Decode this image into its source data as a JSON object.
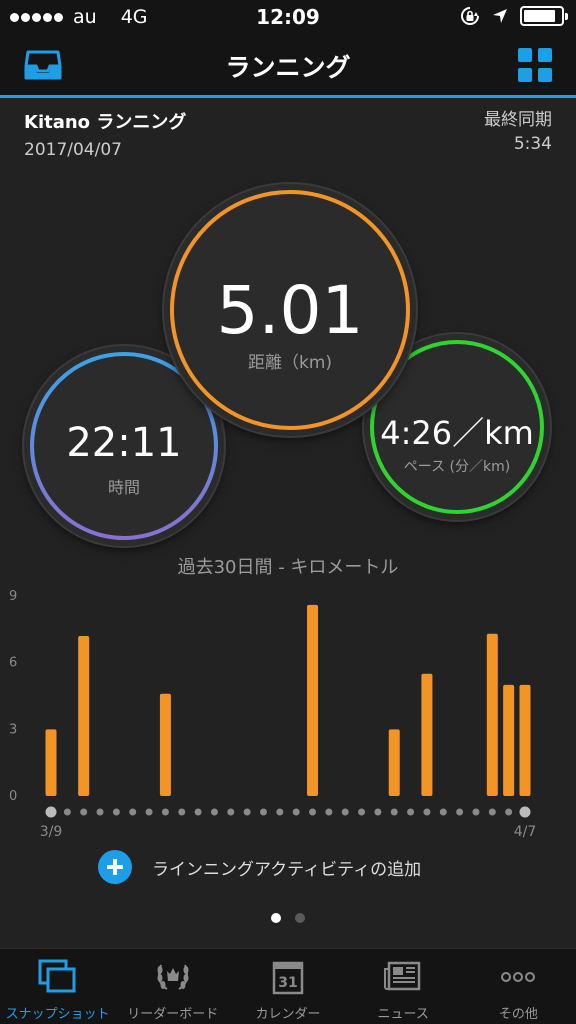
{
  "status_bar": {
    "carrier": "au",
    "network": "4G",
    "time": "12:09",
    "battery_level": 0.85
  },
  "nav": {
    "title": "ランニング",
    "left_icon": "inbox-icon",
    "right_icon": "widgets-grid-icon",
    "accent": "#1f9ee8"
  },
  "activity": {
    "name": "Kitano ランニング",
    "date": "2017/04/07",
    "last_sync_label": "最終同期",
    "last_sync_time": "5:34"
  },
  "metrics": {
    "distance": {
      "value": "5.01",
      "label": "距離（km)",
      "color": "#f39526"
    },
    "time": {
      "value": "22:11",
      "label": "時間",
      "color": "#3aa3e6"
    },
    "pace": {
      "value": "4:26／km",
      "label": "ペース (分／km)",
      "color": "#2fd42f"
    }
  },
  "chart_title": "過去30日間 - キロメートル",
  "chart_data": {
    "type": "bar",
    "color": "#f39526",
    "ylim": [
      0,
      9
    ],
    "yticks": [
      "0",
      "3",
      "6",
      "9"
    ],
    "x_start_label": "3/9",
    "x_end_label": "4/7",
    "days": 30,
    "values": [
      3.0,
      0,
      7.2,
      0,
      0,
      0,
      0,
      4.6,
      0,
      0,
      0,
      0,
      0,
      0,
      0,
      0,
      8.6,
      0,
      0,
      0,
      0,
      3.0,
      0,
      5.5,
      0,
      0,
      0,
      7.3,
      5.0,
      5.0
    ]
  },
  "add_activity": {
    "label": "ラインニングアクティビティの追加"
  },
  "pager": {
    "count": 2,
    "active": 0
  },
  "tabs": [
    {
      "label": "スナップショット",
      "icon": "snapshot-icon",
      "active": true
    },
    {
      "label": "リーダーボード",
      "icon": "laurel-icon",
      "active": false
    },
    {
      "label": "カレンダー",
      "icon": "calendar-icon",
      "calendar_day": "31",
      "active": false
    },
    {
      "label": "ニュース",
      "icon": "news-icon",
      "active": false
    },
    {
      "label": "その他",
      "icon": "more-icon",
      "active": false
    }
  ]
}
